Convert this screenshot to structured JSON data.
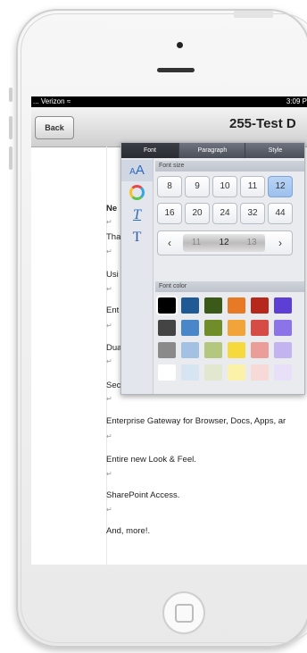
{
  "status": {
    "carrier": "... Verizon",
    "time": "3:09 P"
  },
  "navbar": {
    "back_label": "Back",
    "title": "255-Test D"
  },
  "popover": {
    "tabs": [
      "Font",
      "Paragraph",
      "Style"
    ],
    "font_size_label": "Font size",
    "sizes_row1": [
      "8",
      "9",
      "10",
      "11",
      "12"
    ],
    "sizes_row2": [
      "16",
      "20",
      "24",
      "32",
      "44"
    ],
    "selected_size": "12",
    "stepper": {
      "prev": "11",
      "current": "12",
      "next": "13"
    },
    "font_color_label": "Font color",
    "colors": [
      [
        "#000000",
        "#1f5a94",
        "#3b5a1a",
        "#e87a25",
        "#b7281c",
        "#5d3fd6"
      ],
      [
        "#444444",
        "#4a87c8",
        "#6f8e29",
        "#f2a43a",
        "#d64c45",
        "#8d73e8"
      ],
      [
        "#8a8a8a",
        "#a3c1e3",
        "#b3c77e",
        "#f6d93c",
        "#eb9d99",
        "#c3b3f1"
      ],
      [
        "#ffffff",
        "#d7e5f3",
        "#e1e8cf",
        "#fbf1a9",
        "#f7d9d7",
        "#e7e0f8"
      ]
    ]
  },
  "doc": {
    "lines": [
      "Ne",
      "Tha",
      "Usi",
      "Ent",
      "Dua",
      "Sec",
      "Enterprise Gateway for Browser, Docs, Apps, ar",
      "Entire new Look & Feel.",
      "SharePoint Access.",
      "And, more!."
    ]
  }
}
